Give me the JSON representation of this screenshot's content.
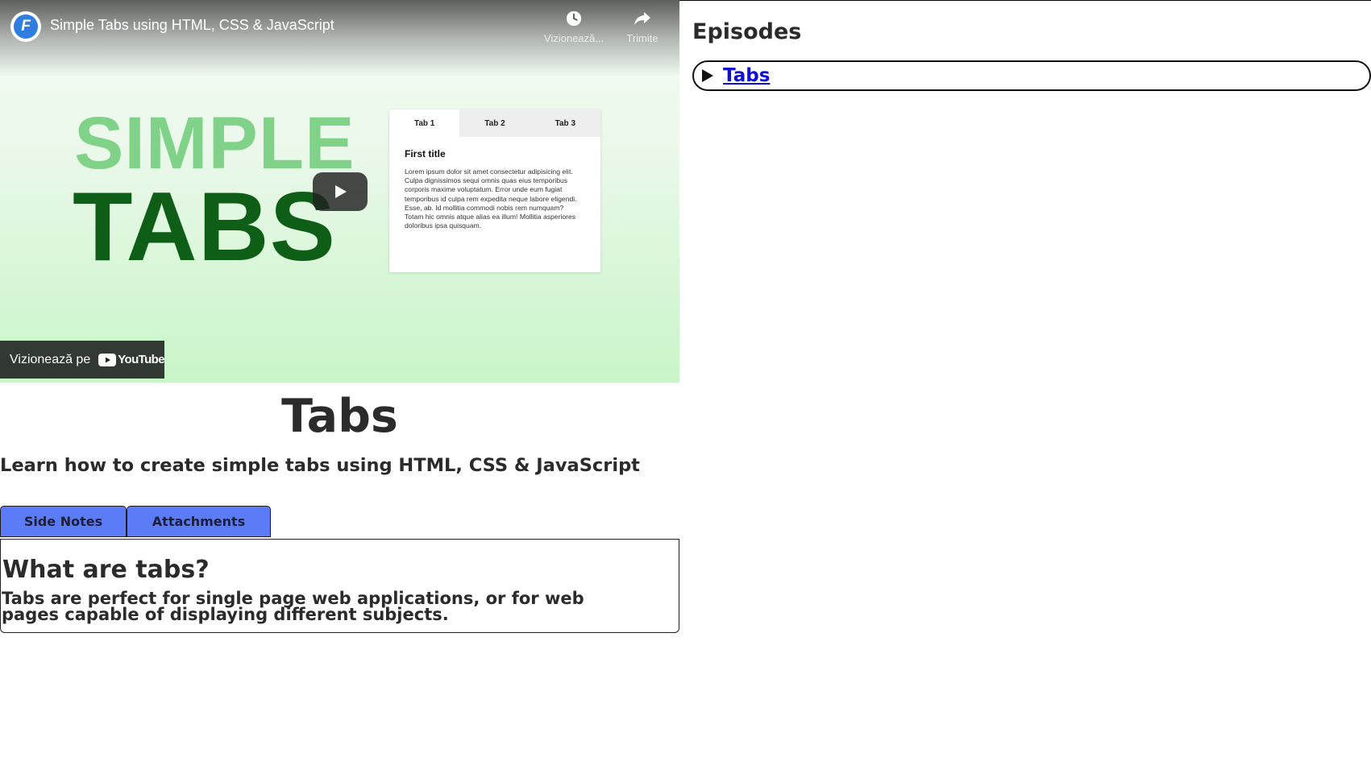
{
  "video": {
    "title": "Simple Tabs using HTML, CSS & JavaScript",
    "channel_logo_letter": "F",
    "actions": [
      {
        "label": "Vizionează...",
        "icon": "clock-icon"
      },
      {
        "label": "Trimite",
        "icon": "share-icon"
      }
    ],
    "thumbnail": {
      "headline_top": "SIMPLE",
      "headline_bottom": "TABS",
      "card_tabs": [
        "Tab 1",
        "Tab 2",
        "Tab 3"
      ],
      "card_title": "First title",
      "card_body": "Lorem ipsum dolor sit amet consectetur adipisicing elit. Culpa dignissimos sequi omnis quas eius temporibus corporis maxime voluptatum. Error unde eum fugiat temporibus id culpa rem expedita neque labore eligendi. Esse, ab. Id mollitia commodi nobis rem numquam? Totam hic omnis atque alias ea illum! Mollitia asperiores doloribus ipsa quisquam."
    },
    "watch_on_label": "Vizionează pe",
    "youtube_wordmark": "YouTube",
    "colors": {
      "accent_light": "#7fd287",
      "accent_dark": "#0f5e17",
      "youtube_red": "#ff0000"
    }
  },
  "lesson": {
    "title": "Tabs",
    "subtitle": "Learn how to create simple tabs using HTML, CSS & JavaScript",
    "tabs": [
      {
        "label": "Side Notes",
        "active": true
      },
      {
        "label": "Attachments",
        "active": false
      }
    ],
    "panel": {
      "heading": "What are tabs?",
      "text": "Tabs are perfect for single page web applications, or for web pages capable of displaying different subjects."
    },
    "colors": {
      "tab_bg": "#5c7cf7"
    }
  },
  "episodes": {
    "heading": "Episodes",
    "items": [
      {
        "label": "Tabs"
      }
    ],
    "colors": {
      "link": "#0d0dd6"
    }
  }
}
